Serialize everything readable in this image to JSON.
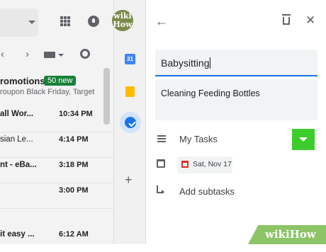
{
  "header": {
    "avatar_text": "wiki\nHow"
  },
  "inbox": {
    "promotions": {
      "title": "romotions",
      "badge": "50 new",
      "subtitle": "roupon Black Friday, Target"
    },
    "rows": [
      {
        "sender": "all Wor...",
        "time": "10:34 PM",
        "bold": true
      },
      {
        "sender": "sian Le...",
        "time": "4:14 PM",
        "bold": false
      },
      {
        "sender": "nt - eBa...",
        "time": "3:18 PM",
        "bold": true
      },
      {
        "sender": "",
        "time": "3:00 PM",
        "bold": false
      },
      {
        "sender": "it easy ...",
        "time": "6:12 AM",
        "bold": true
      }
    ]
  },
  "addons": {
    "calendar_label": "31"
  },
  "task": {
    "title": "Babysitting",
    "details": "Cleaning Feeding Bottles",
    "list_name": "My Tasks",
    "due_date": "Sat, Nov 17",
    "add_subtasks": "Add subtasks"
  },
  "colors": {
    "accent": "#1a73e8",
    "highlight": "#3ccd2c",
    "badge": "#188038"
  },
  "watermark": {
    "wiki": "wiki",
    "how": "How"
  }
}
